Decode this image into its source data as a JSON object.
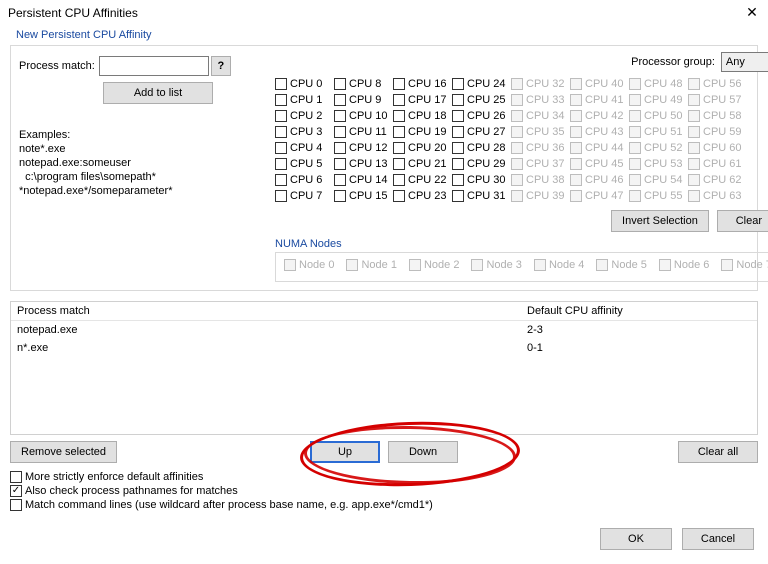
{
  "title": "Persistent CPU Affinities",
  "group_label": "New Persistent CPU Affinity",
  "process_match_label": "Process match:",
  "process_match_value": "",
  "add_to_list": "Add to list",
  "examples_heading": "Examples:",
  "examples": [
    "note*.exe",
    "notepad.exe:someuser",
    "  c:\\program files\\somepath*",
    "*notepad.exe*/someparameter*"
  ],
  "processor_group_label": "Processor group:",
  "processor_group_value": "Any",
  "cpu_prefix": "CPU ",
  "cpu_count": 64,
  "cpu_enabled_up_to": 32,
  "invert_selection": "Invert Selection",
  "clear": "Clear",
  "numa_title": "NUMA Nodes",
  "numa_prefix": "Node ",
  "numa_count": 8,
  "list_headers": {
    "col1": "Process match",
    "col2": "Default CPU affinity"
  },
  "list_rows": [
    {
      "match": "notepad.exe",
      "affinity": "2-3"
    },
    {
      "match": "n*.exe",
      "affinity": "0-1"
    }
  ],
  "remove_selected": "Remove selected",
  "up": "Up",
  "down": "Down",
  "clear_all": "Clear all",
  "opt1": {
    "checked": false,
    "label": "More strictly enforce default affinities"
  },
  "opt2": {
    "checked": true,
    "label": "Also check process pathnames for matches"
  },
  "opt3": {
    "checked": false,
    "label": "Match command lines (use wildcard after process base name, e.g. app.exe*/cmd1*)"
  },
  "ok": "OK",
  "cancel": "Cancel"
}
